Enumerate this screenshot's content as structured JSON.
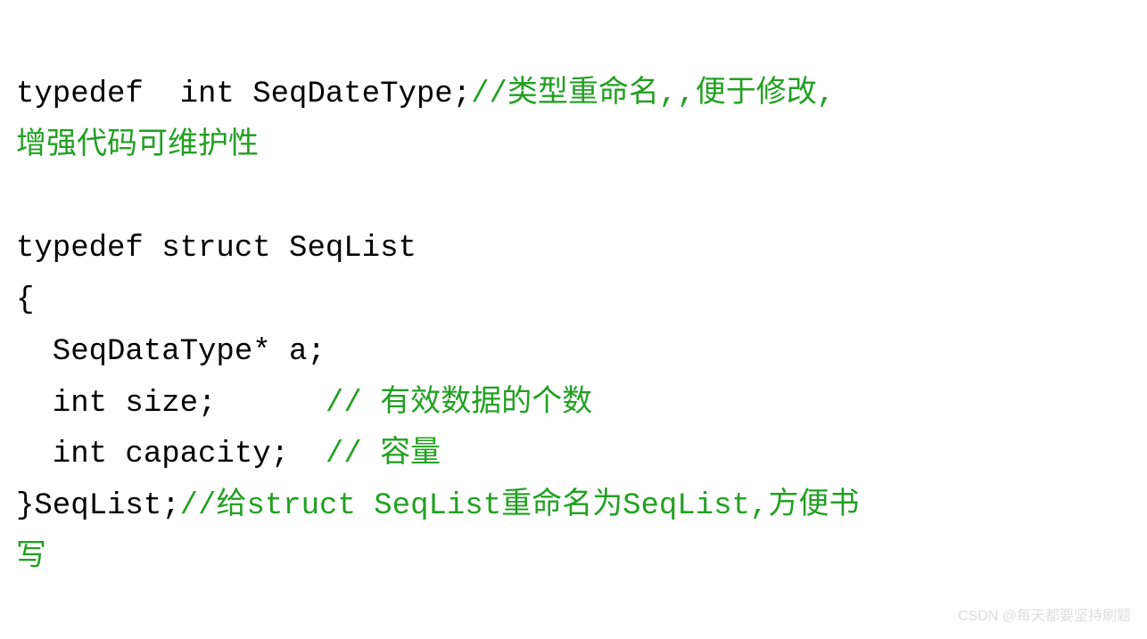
{
  "code": {
    "line1_code": "typedef  int SeqDateType;",
    "line1_comment": "//类型重命名,,便于修改,",
    "line2_comment": "增强代码可维护性",
    "line3_blank": "",
    "line4_code": "typedef struct SeqList",
    "line5_code": "{",
    "line6_code": "  SeqDataType* a;",
    "line7_code": "  int size;      ",
    "line7_comment": "// 有效数据的个数",
    "line8_code": "  int capacity;  ",
    "line8_comment": "// 容量",
    "line9_code": "}SeqList;",
    "line9_comment": "//给struct SeqList重命名为SeqList,方便书",
    "line10_comment": "写"
  },
  "watermark": "CSDN @每天都要坚持刷题"
}
